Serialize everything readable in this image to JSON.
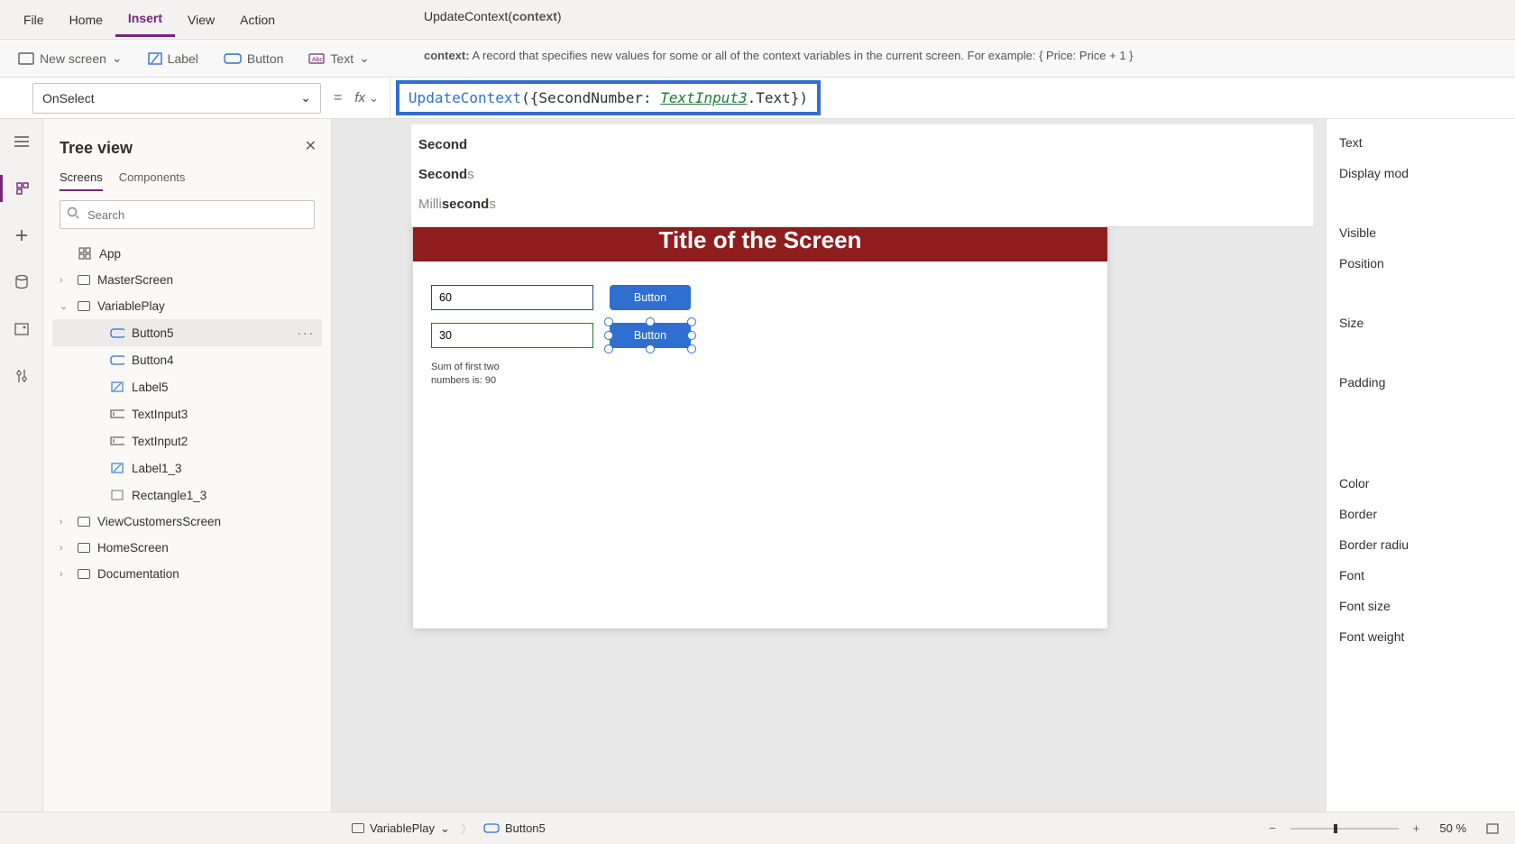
{
  "menu": {
    "file": "File",
    "home": "Home",
    "insert": "Insert",
    "view": "View",
    "action": "Action",
    "active": "insert"
  },
  "signature": {
    "fn": "UpdateContext",
    "param": "context"
  },
  "ribbon": {
    "newScreen": "New screen",
    "label": "Label",
    "button": "Button",
    "text": "Text",
    "hintLabel": "context:",
    "hintText": "A record that specifies new values for some or all of the context variables in the current screen. For example: { Price: Price + 1 }"
  },
  "formula": {
    "property": "OnSelect",
    "fx": "fx",
    "func": "UpdateContext",
    "pre": "({SecondNumber: ",
    "ident": "TextInput3",
    "post": ".Text})"
  },
  "autocomplete": [
    {
      "match": "Second",
      "rest": ""
    },
    {
      "match": "Second",
      "rest": "s"
    },
    {
      "pre": "Milli",
      "match": "second",
      "rest": "s"
    }
  ],
  "tree": {
    "title": "Tree view",
    "tabs": {
      "screens": "Screens",
      "components": "Components",
      "active": "screens"
    },
    "searchPlaceholder": "Search",
    "items": [
      {
        "id": "app",
        "label": "App",
        "icon": "app",
        "depth": 0,
        "expandable": false
      },
      {
        "id": "master",
        "label": "MasterScreen",
        "icon": "screen",
        "depth": 0,
        "expandable": true,
        "expanded": false
      },
      {
        "id": "varplay",
        "label": "VariablePlay",
        "icon": "screen",
        "depth": 0,
        "expandable": true,
        "expanded": true
      },
      {
        "id": "button5",
        "label": "Button5",
        "icon": "button",
        "depth": 2,
        "selected": true
      },
      {
        "id": "button4",
        "label": "Button4",
        "icon": "button",
        "depth": 2
      },
      {
        "id": "label5",
        "label": "Label5",
        "icon": "label",
        "depth": 2
      },
      {
        "id": "ti3",
        "label": "TextInput3",
        "icon": "textinput",
        "depth": 2
      },
      {
        "id": "ti2",
        "label": "TextInput2",
        "icon": "textinput",
        "depth": 2
      },
      {
        "id": "label13",
        "label": "Label1_3",
        "icon": "label",
        "depth": 2
      },
      {
        "id": "rect13",
        "label": "Rectangle1_3",
        "icon": "rect",
        "depth": 2
      },
      {
        "id": "viewcust",
        "label": "ViewCustomersScreen",
        "icon": "screen",
        "depth": 0,
        "expandable": true,
        "expanded": false
      },
      {
        "id": "homescr",
        "label": "HomeScreen",
        "icon": "screen",
        "depth": 0,
        "expandable": true,
        "expanded": false
      },
      {
        "id": "doc",
        "label": "Documentation",
        "icon": "screen",
        "depth": 0,
        "expandable": true,
        "expanded": false
      }
    ]
  },
  "canvas": {
    "screenTitle": "Title of the Screen",
    "input1": "60",
    "input2": "30",
    "button1": "Button",
    "button2": "Button",
    "sumLabel": "Sum of first two numbers is: 90"
  },
  "props": {
    "text": "Text",
    "displayMode": "Display mod",
    "visible": "Visible",
    "position": "Position",
    "size": "Size",
    "padding": "Padding",
    "color": "Color",
    "border": "Border",
    "borderRadius": "Border radiu",
    "font": "Font",
    "fontSize": "Font size",
    "fontWeight": "Font weight"
  },
  "bottom": {
    "screen": "VariablePlay",
    "element": "Button5",
    "zoom": "50",
    "pctSuffix": "%"
  }
}
